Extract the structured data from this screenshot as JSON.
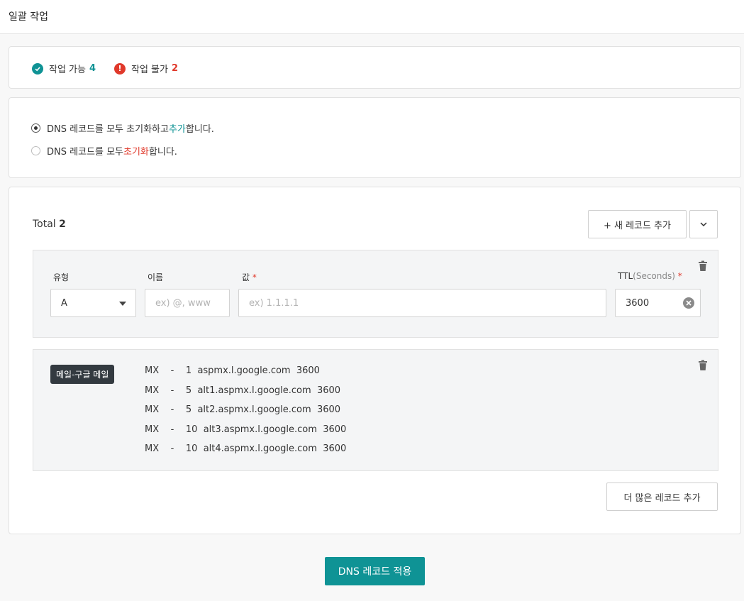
{
  "header": {
    "title": "일괄 작업"
  },
  "status": {
    "possible_label": "작업 가능",
    "possible_count": "4",
    "impossible_label": "작업 불가",
    "impossible_count": "2",
    "possible_color": "#0f9395",
    "impossible_color": "#e0392b",
    "possible_icon": "check-circle-icon",
    "impossible_icon": "exclamation-circle-icon"
  },
  "options": [
    {
      "pre": "DNS 레코드를 모두 초기화하고 ",
      "accent": "추가",
      "post": " 합니다.",
      "accent_color": "#0f9395",
      "selected": true
    },
    {
      "pre": "DNS 레코드를 모두 ",
      "accent": "초기화",
      "post": " 합니다.",
      "accent_color": "#e0392b",
      "selected": false
    }
  ],
  "records": {
    "total_label": "Total",
    "total_count": "2",
    "add_record_label": "+ 새 레코드 추가",
    "dropdown_icon": "chevron-down-icon",
    "form": {
      "type_label": "유형",
      "type_value": "A",
      "name_label": "이름",
      "name_placeholder": "ex) @, www",
      "value_label": "값",
      "value_required": "*",
      "value_placeholder": "ex) 1.1.1.1",
      "ttl_label": "TTL",
      "ttl_unit": "(Seconds)",
      "ttl_required": "*",
      "ttl_value": "3600"
    },
    "preset": {
      "tag": "메일-구글 메일",
      "rows": [
        {
          "type": "MX",
          "name": "-",
          "priority": "1",
          "value": "aspmx.l.google.com",
          "ttl": "3600"
        },
        {
          "type": "MX",
          "name": "-",
          "priority": "5",
          "value": "alt1.aspmx.l.google.com",
          "ttl": "3600"
        },
        {
          "type": "MX",
          "name": "-",
          "priority": "5",
          "value": "alt2.aspmx.l.google.com",
          "ttl": "3600"
        },
        {
          "type": "MX",
          "name": "-",
          "priority": "10",
          "value": "alt3.aspmx.l.google.com",
          "ttl": "3600"
        },
        {
          "type": "MX",
          "name": "-",
          "priority": "10",
          "value": "alt4.aspmx.l.google.com",
          "ttl": "3600"
        }
      ]
    },
    "more_label": "더 많은 레코드 추가"
  },
  "apply_label": "DNS 레코드 적용",
  "accent_color": "#0f9395"
}
